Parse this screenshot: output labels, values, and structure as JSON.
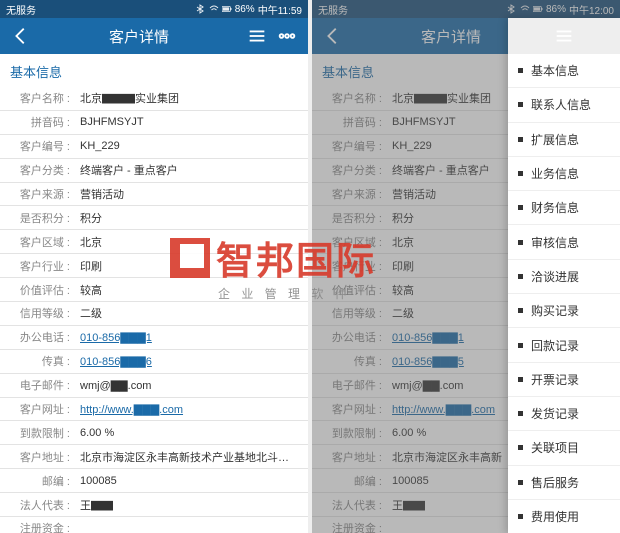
{
  "statusbar": {
    "carrier": "无服务",
    "battery": "86%",
    "time_left": "中午11:59",
    "time_right": "中午12:00"
  },
  "header": {
    "title": "客户详情"
  },
  "section": {
    "basic": "基本信息"
  },
  "rows": [
    {
      "label": "客户名称",
      "value": "北京▇▇▇实业集团"
    },
    {
      "label": "拼音码",
      "value": "BJHFMSYJT"
    },
    {
      "label": "客户编号",
      "value": "KH_229"
    },
    {
      "label": "客户分类",
      "value": "终端客户 - 重点客户"
    },
    {
      "label": "客户来源",
      "value": "营销活动"
    },
    {
      "label": "是否积分",
      "value": "积分"
    },
    {
      "label": "客户区域",
      "value": "北京"
    },
    {
      "label": "客户行业",
      "value": "印刷"
    },
    {
      "label": "价值评估",
      "value": "较高"
    },
    {
      "label": "信用等级",
      "value": "二级"
    },
    {
      "label": "办公电话",
      "value": "010-856▇▇▇1",
      "link": true
    },
    {
      "label": "传真",
      "value": "010-856▇▇▇6",
      "link": true
    },
    {
      "label": "电子邮件",
      "value": "wmj@▇▇.com"
    },
    {
      "label": "客户网址",
      "value": "http://www.▇▇▇.com",
      "link": true
    },
    {
      "label": "到款限制",
      "value": "6.00 %"
    },
    {
      "label": "客户地址",
      "value": "北京市海淀区永丰高新技术产业基地北斗星通大厦"
    },
    {
      "label": "邮编",
      "value": "100085"
    },
    {
      "label": "法人代表",
      "value": "王▇▇"
    },
    {
      "label": "注册资金",
      "value": ""
    }
  ],
  "right_address": "北京市海淀区永丰高新",
  "drawer": {
    "items": [
      "基本信息",
      "联系人信息",
      "扩展信息",
      "业务信息",
      "财务信息",
      "审核信息",
      "洽谈进展",
      "购买记录",
      "回款记录",
      "开票记录",
      "发货记录",
      "关联项目",
      "售后服务",
      "费用使用"
    ]
  },
  "watermark": {
    "brand": "智邦国际",
    "tagline": "企 业 管 理 软 件"
  }
}
